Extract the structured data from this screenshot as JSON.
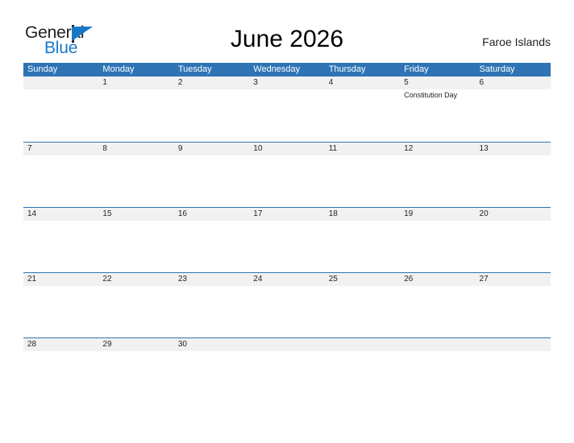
{
  "brand": {
    "name_part1": "General",
    "name_part2": "Blue",
    "logo_icon": "triangle-logo-icon"
  },
  "header": {
    "title": "June 2026",
    "region": "Faroe Islands"
  },
  "calendar": {
    "weekdays": [
      "Sunday",
      "Monday",
      "Tuesday",
      "Wednesday",
      "Thursday",
      "Friday",
      "Saturday"
    ],
    "colors": {
      "header_blue": "#2E74B5",
      "band_gray": "#F1F1F1",
      "brand_blue": "#1878C8",
      "text_dark": "#231F20"
    },
    "weeks": [
      [
        {
          "date": "",
          "event": ""
        },
        {
          "date": "1",
          "event": ""
        },
        {
          "date": "2",
          "event": ""
        },
        {
          "date": "3",
          "event": ""
        },
        {
          "date": "4",
          "event": ""
        },
        {
          "date": "5",
          "event": "Constitution Day"
        },
        {
          "date": "6",
          "event": ""
        }
      ],
      [
        {
          "date": "7",
          "event": ""
        },
        {
          "date": "8",
          "event": ""
        },
        {
          "date": "9",
          "event": ""
        },
        {
          "date": "10",
          "event": ""
        },
        {
          "date": "11",
          "event": ""
        },
        {
          "date": "12",
          "event": ""
        },
        {
          "date": "13",
          "event": ""
        }
      ],
      [
        {
          "date": "14",
          "event": ""
        },
        {
          "date": "15",
          "event": ""
        },
        {
          "date": "16",
          "event": ""
        },
        {
          "date": "17",
          "event": ""
        },
        {
          "date": "18",
          "event": ""
        },
        {
          "date": "19",
          "event": ""
        },
        {
          "date": "20",
          "event": ""
        }
      ],
      [
        {
          "date": "21",
          "event": ""
        },
        {
          "date": "22",
          "event": ""
        },
        {
          "date": "23",
          "event": ""
        },
        {
          "date": "24",
          "event": ""
        },
        {
          "date": "25",
          "event": ""
        },
        {
          "date": "26",
          "event": ""
        },
        {
          "date": "27",
          "event": ""
        }
      ],
      [
        {
          "date": "28",
          "event": ""
        },
        {
          "date": "29",
          "event": ""
        },
        {
          "date": "30",
          "event": ""
        },
        {
          "date": "",
          "event": ""
        },
        {
          "date": "",
          "event": ""
        },
        {
          "date": "",
          "event": ""
        },
        {
          "date": "",
          "event": ""
        }
      ]
    ]
  }
}
